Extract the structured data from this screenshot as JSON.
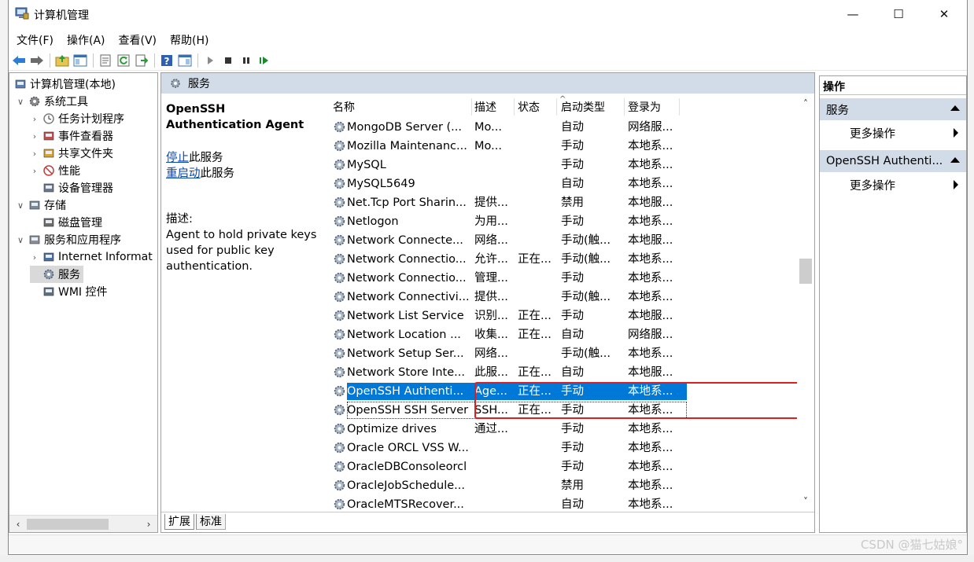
{
  "window": {
    "title": "计算机管理",
    "controls": {
      "minimize": "—",
      "maximize": "☐",
      "close": "✕"
    }
  },
  "menu": [
    "文件(F)",
    "操作(A)",
    "查看(V)",
    "帮助(H)"
  ],
  "tree": [
    {
      "label": "计算机管理(本地)",
      "level": 0,
      "caret": "",
      "icon": "computer-icon"
    },
    {
      "label": "系统工具",
      "level": 1,
      "caret": "∨",
      "icon": "tools-icon"
    },
    {
      "label": "任务计划程序",
      "level": 2,
      "caret": "›",
      "icon": "clock-icon"
    },
    {
      "label": "事件查看器",
      "level": 2,
      "caret": "›",
      "icon": "event-viewer-icon"
    },
    {
      "label": "共享文件夹",
      "level": 2,
      "caret": "›",
      "icon": "shared-folder-icon"
    },
    {
      "label": "性能",
      "level": 2,
      "caret": "›",
      "icon": "performance-icon"
    },
    {
      "label": "设备管理器",
      "level": 2,
      "caret": "",
      "icon": "device-manager-icon"
    },
    {
      "label": "存储",
      "level": 1,
      "caret": "∨",
      "icon": "storage-icon"
    },
    {
      "label": "磁盘管理",
      "level": 2,
      "caret": "",
      "icon": "disk-icon"
    },
    {
      "label": "服务和应用程序",
      "level": 1,
      "caret": "∨",
      "icon": "services-apps-icon"
    },
    {
      "label": "Internet Informat",
      "level": 2,
      "caret": "›",
      "icon": "iis-icon"
    },
    {
      "label": "服务",
      "level": 2,
      "caret": "",
      "icon": "services-icon",
      "selected": true
    },
    {
      "label": "WMI 控件",
      "level": 2,
      "caret": "",
      "icon": "wmi-icon"
    }
  ],
  "center": {
    "header": "服务",
    "detail": {
      "service_name": "OpenSSH Authentication Agent",
      "stop_link": "停止",
      "stop_suffix": "此服务",
      "restart_link": "重启动",
      "restart_suffix": "此服务",
      "desc_label": "描述:",
      "desc_text": "Agent to hold private keys used for public key authentication."
    },
    "columns": [
      "名称",
      "描述",
      "状态",
      "启动类型",
      "登录为"
    ],
    "rows": [
      [
        "MongoDB Server (...",
        "Mo...",
        "",
        "自动",
        "网络服..."
      ],
      [
        "Mozilla Maintenanc...",
        "Mo...",
        "",
        "手动",
        "本地系..."
      ],
      [
        "MySQL",
        "",
        "",
        "手动",
        "本地系..."
      ],
      [
        "MySQL5649",
        "",
        "",
        "自动",
        "本地系..."
      ],
      [
        "Net.Tcp Port Sharin...",
        "提供...",
        "",
        "禁用",
        "本地服..."
      ],
      [
        "Netlogon",
        "为用...",
        "",
        "手动",
        "本地系..."
      ],
      [
        "Network Connecte...",
        "网络...",
        "",
        "手动(触...",
        "本地服..."
      ],
      [
        "Network Connectio...",
        "允许...",
        "正在...",
        "手动(触...",
        "本地系..."
      ],
      [
        "Network Connectio...",
        "管理...",
        "",
        "手动",
        "本地系..."
      ],
      [
        "Network Connectivi...",
        "提供...",
        "",
        "手动(触...",
        "本地系..."
      ],
      [
        "Network List Service",
        "识别...",
        "正在...",
        "手动",
        "本地服..."
      ],
      [
        "Network Location ...",
        "收集...",
        "正在...",
        "自动",
        "网络服..."
      ],
      [
        "Network Setup Ser...",
        "网络...",
        "",
        "手动(触...",
        "本地系..."
      ],
      [
        "Network Store Inte...",
        "此服...",
        "正在...",
        "自动",
        "本地服..."
      ],
      [
        "OpenSSH Authenti...",
        "Age...",
        "正在...",
        "手动",
        "本地系..."
      ],
      [
        "OpenSSH SSH Server",
        "SSH...",
        "正在...",
        "手动",
        "本地系..."
      ],
      [
        "Optimize drives",
        "通过...",
        "",
        "手动",
        "本地系..."
      ],
      [
        "Oracle ORCL VSS W...",
        "",
        "",
        "手动",
        "本地系..."
      ],
      [
        "OracleDBConsoleorcl",
        "",
        "",
        "手动",
        "本地系..."
      ],
      [
        "OracleJobSchedule...",
        "",
        "",
        "禁用",
        "本地系..."
      ],
      [
        "OracleMTSRecover...",
        "",
        "",
        "自动",
        "本地系..."
      ]
    ],
    "selected_row": 14,
    "focused_row": 15,
    "tabs": [
      "扩展",
      "标准"
    ]
  },
  "actions": {
    "title": "操作",
    "section1": "服务",
    "section1_item": "更多操作",
    "section2": "OpenSSH Authenti...",
    "section2_item": "更多操作"
  },
  "watermark": "CSDN @猫七姑娘°",
  "colors": {
    "selection": "#0078d7",
    "pane_header": "#d2dbe8",
    "highlight_box": "#e01e1e",
    "link": "#0645ad"
  }
}
